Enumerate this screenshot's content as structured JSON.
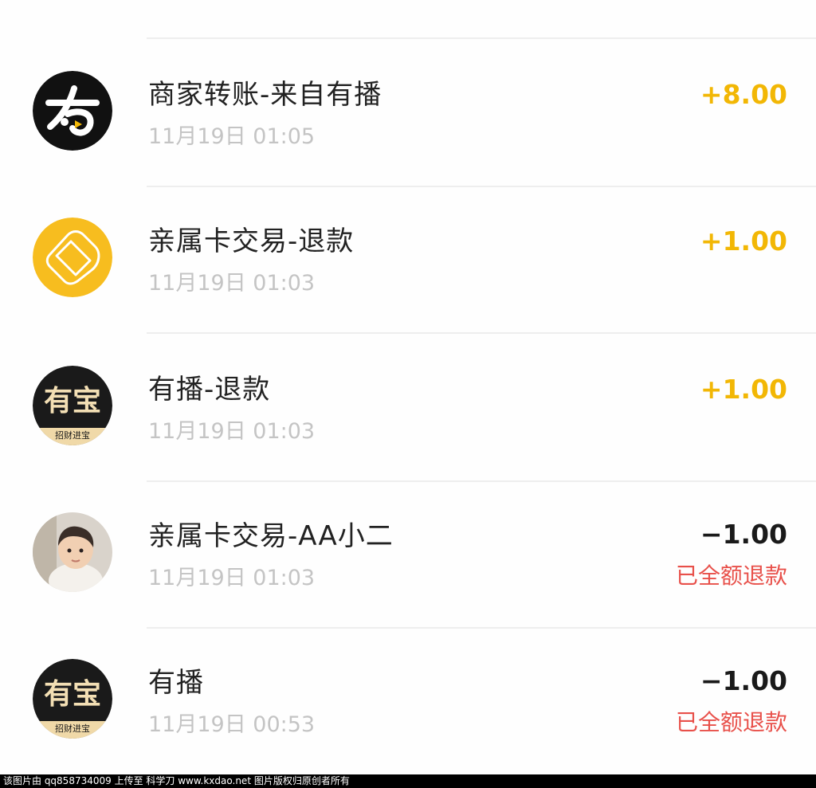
{
  "transactions": [
    {
      "title": "商家转账-来自有播",
      "time": "11月19日 01:05",
      "amount": "+8.00",
      "avatar": "youbo-logo-icon"
    },
    {
      "title": "亲属卡交易-退款",
      "time": "11月19日 01:03",
      "amount": "+1.00",
      "avatar": "family-card-icon"
    },
    {
      "title": "有播-退款",
      "time": "11月19日 01:03",
      "amount": "+1.00",
      "avatar": "youbao-logo-icon",
      "avatar_text": "有宝",
      "avatar_subtext": "招财进宝"
    },
    {
      "title": "亲属卡交易-AA小二",
      "time": "11月19日 01:03",
      "amount": "−1.00",
      "status": "已全额退款",
      "avatar": "child-photo-avatar"
    },
    {
      "title": "有播",
      "time": "11月19日 00:53",
      "amount": "−1.00",
      "status": "已全额退款",
      "avatar": "youbao-logo-icon",
      "avatar_text": "有宝",
      "avatar_subtext": "招财进宝"
    }
  ],
  "watermark": "该图片由 qq858734009 上传至 科学刀 www.kxdao.net 图片版权归原创者所有",
  "colors": {
    "positive_amount": "#f2b705",
    "negative_amount": "#1a1a1a",
    "refund_status": "#e8504a",
    "time_text": "#c4c4c4",
    "family_card_bg": "#f7bd1f"
  }
}
